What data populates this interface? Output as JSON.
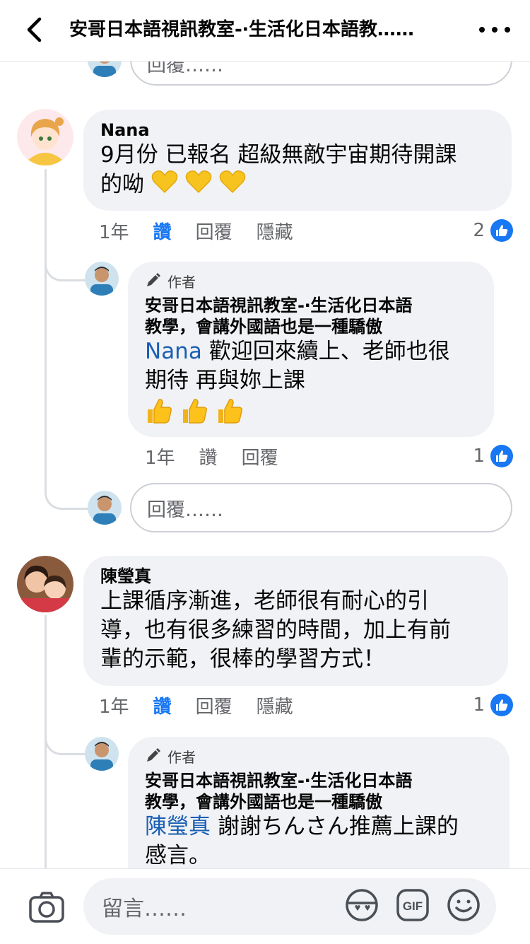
{
  "header": {
    "title": "安哥日本語視訊教室-‧生活化日本語教……"
  },
  "top_reply_box": {
    "placeholder": "回覆……"
  },
  "comments": [
    {
      "author": "Nana",
      "text_line1": "9月份 已報名 超級無敵宇宙期待開課",
      "text_line2": "的呦",
      "time": "1年",
      "like_label": "讚",
      "reply_label": "回覆",
      "hide_label": "隱藏",
      "like_count": "2",
      "reply": {
        "badge": "作者",
        "author_line1": "安哥日本語視訊教室-‧生活化日本語",
        "author_line2": "教學，會講外國語也是一種驕傲",
        "mention": "Nana",
        "text_line1_rest": " 歡迎回來續上、老師也很",
        "text_line2": "期待 再與妳上課",
        "time": "1年",
        "like_label": "讚",
        "reply_label": "回覆",
        "like_count": "1"
      },
      "reply_box_placeholder": "回覆……"
    },
    {
      "author": "陳瑩真",
      "text_line1": "上課循序漸進，老師很有耐心的引",
      "text_line2": "導，也有很多練習的時間，加上有前",
      "text_line3": "輩的示範，很棒的學習方式！",
      "time": "1年",
      "like_label": "讚",
      "reply_label": "回覆",
      "hide_label": "隱藏",
      "like_count": "1",
      "reply": {
        "badge": "作者",
        "author_line1": "安哥日本語視訊教室-‧生活化日本語",
        "author_line2": "教學，會講外國語也是一種驕傲",
        "mention": "陳瑩真",
        "text_line1_rest": " 謝謝ちんさん推薦上課的",
        "text_line2": "感言。"
      }
    }
  ],
  "composer": {
    "placeholder": "留言……"
  },
  "icons": {
    "back": "back-arrow-icon",
    "more": "more-dots-icon",
    "like": "thumbs-up-icon",
    "camera": "camera-icon",
    "avatar_sticker": "sticker-icon",
    "gif": "gif-icon",
    "emoji": "smiley-icon"
  },
  "colors": {
    "accent": "#1877f2",
    "bubble": "#f0f2f5",
    "mention": "#1a5fb4",
    "muted": "#65676b"
  }
}
